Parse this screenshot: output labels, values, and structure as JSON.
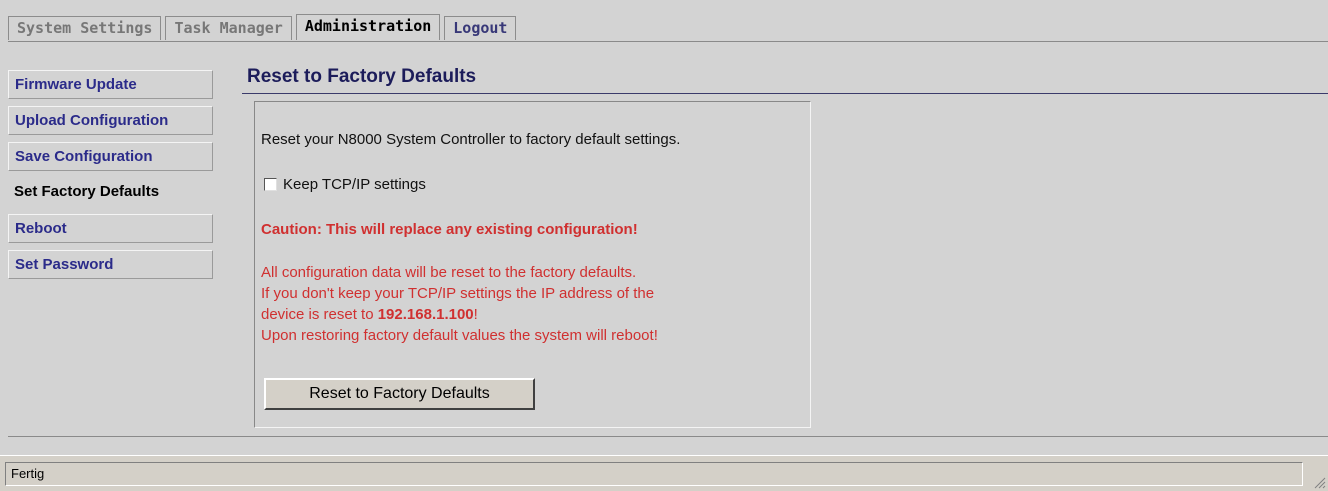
{
  "tabs": [
    {
      "label": "System Settings"
    },
    {
      "label": "Task Manager"
    },
    {
      "label": "Administration"
    },
    {
      "label": "Logout"
    }
  ],
  "sidebar": {
    "items": [
      {
        "label": "Firmware Update"
      },
      {
        "label": "Upload Configuration"
      },
      {
        "label": "Save Configuration"
      },
      {
        "label": "Set Factory Defaults"
      },
      {
        "label": "Reboot"
      },
      {
        "label": "Set Password"
      }
    ]
  },
  "main": {
    "title": "Reset to Factory Defaults",
    "intro": "Reset your N8000 System Controller to factory default settings.",
    "checkbox_label": "Keep TCP/IP settings",
    "checkbox_checked": false,
    "caution": "Caution: This will replace any existing configuration!",
    "warning_line1": "All configuration data will be reset to the factory defaults.",
    "warning_line2": "If you don't keep your TCP/IP settings the IP address of the",
    "warning_line3_prefix": "device is reset to ",
    "warning_line3_ip": "192.168.1.100",
    "warning_line3_suffix": "!",
    "warning_line4": "Upon restoring factory default values the system will reboot!",
    "button_label": "Reset to Factory Defaults"
  },
  "statusbar": {
    "text": "Fertig"
  },
  "colors": {
    "link": "#2b2b8a",
    "warning": "#d03030",
    "title": "#1c1c5a",
    "background": "#d3d3d3"
  }
}
